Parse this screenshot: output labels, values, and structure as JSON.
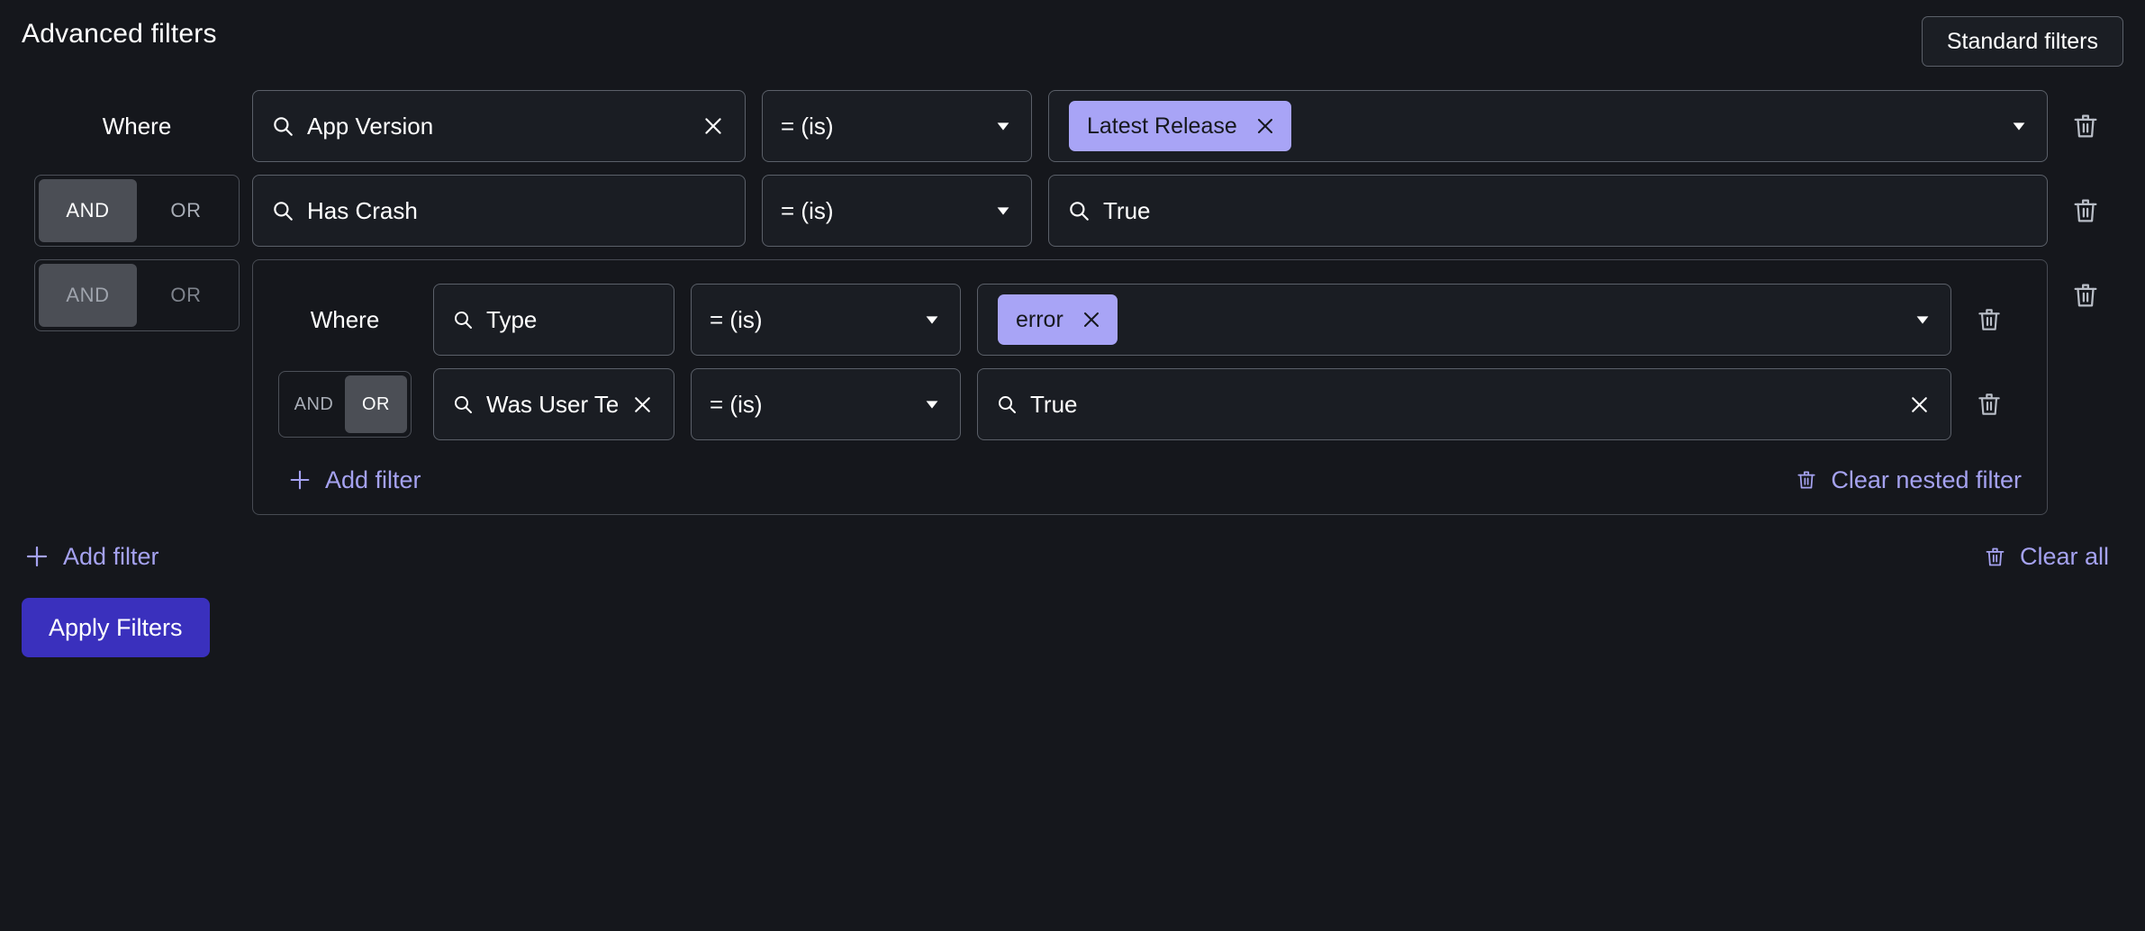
{
  "header": {
    "title": "Advanced filters",
    "standard_filters_label": "Standard filters"
  },
  "labels": {
    "where": "Where",
    "and": "AND",
    "or": "OR"
  },
  "rows": [
    {
      "conjunction": null,
      "prefix_label": "Where",
      "key": "App Version",
      "key_has_clear": true,
      "operator": "= (is)",
      "value_type": "chips",
      "chips": [
        "Latest Release"
      ],
      "value_has_caret": true
    },
    {
      "conjunction": "AND",
      "conjunction_disabled": false,
      "key": "Has Crash",
      "key_has_clear": false,
      "operator": "= (is)",
      "value_type": "search",
      "value": "True",
      "value_has_clear": false,
      "value_has_caret": false
    },
    {
      "conjunction": "AND",
      "conjunction_disabled": true
    }
  ],
  "nested_group": {
    "rows": [
      {
        "prefix_label": "Where",
        "key": "Type",
        "key_has_clear": false,
        "operator": "= (is)",
        "value_type": "chips",
        "chips": [
          "error"
        ],
        "value_has_caret": true
      },
      {
        "conjunction": "OR",
        "key": "Was User Terminated",
        "key_has_clear": true,
        "operator": "= (is)",
        "value_type": "search",
        "value": "True",
        "value_has_clear": true,
        "value_has_caret": false
      }
    ],
    "add_filter_label": "Add filter",
    "clear_nested_label": "Clear nested filter"
  },
  "footer": {
    "add_filter_label": "Add filter",
    "clear_all_label": "Clear all",
    "apply_label": "Apply Filters"
  },
  "colors": {
    "background": "#15171c",
    "field_background": "#1a1d23",
    "border": "#5b6069",
    "chip": "#a8a4f6",
    "link": "#a5a2f0",
    "apply_button": "#3a30bd",
    "segment_active": "#4b4e55"
  }
}
